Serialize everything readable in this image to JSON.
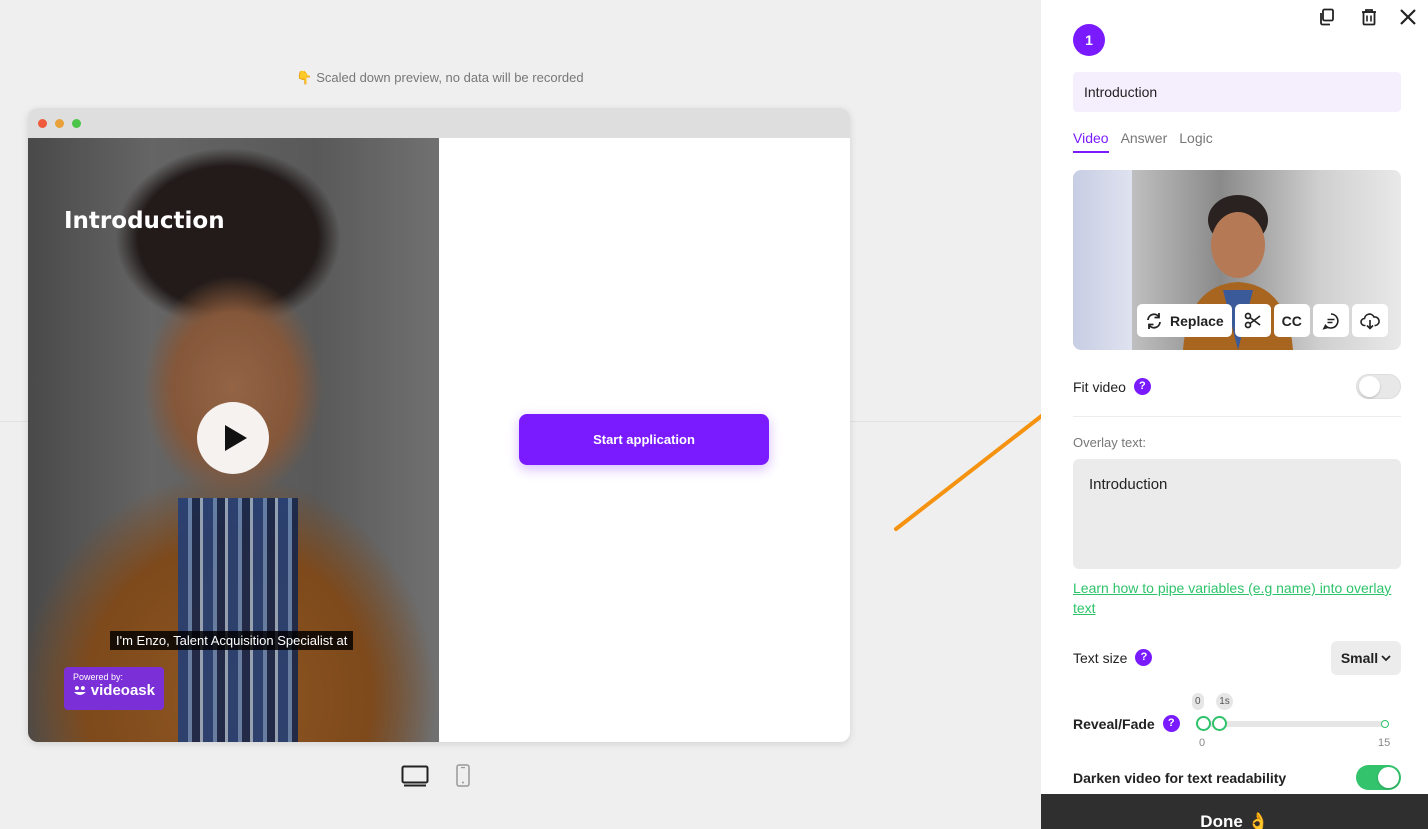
{
  "preview": {
    "note_icon": "👇",
    "note": "Scaled down preview, no data will be recorded",
    "video_title": "Introduction",
    "caption": "I'm Enzo, Talent Acquisition Specialist at",
    "powered_by": "Powered by:",
    "brand": "videoask",
    "start_button": "Start application",
    "devices": [
      "desktop-icon",
      "mobile-icon"
    ]
  },
  "panel": {
    "step_number": "1",
    "title_value": "Introduction",
    "tabs": [
      {
        "label": "Video",
        "active": true
      },
      {
        "label": "Answer",
        "active": false
      },
      {
        "label": "Logic",
        "active": false
      }
    ],
    "video_tools": {
      "replace": "Replace",
      "cc": "CC"
    },
    "fit_video": {
      "label": "Fit video",
      "enabled": false
    },
    "overlay_label": "Overlay text:",
    "overlay_value": "Introduction",
    "learn_link": "Learn how to pipe variables (e.g name) into overlay text",
    "text_size": {
      "label": "Text size",
      "value": "Small"
    },
    "reveal_fade": {
      "label": "Reveal/Fade",
      "bubble_start": "0",
      "bubble_end": "1s",
      "min_label": "0",
      "max_label": "15",
      "range_min": 0,
      "range_max": 15,
      "reveal": 0,
      "fade": 1
    },
    "darken": {
      "label": "Darken video for text readability",
      "enabled": true
    },
    "done": "Done",
    "done_icon": "👌"
  },
  "colors": {
    "accent": "#7a1bff",
    "green": "#2ec36a",
    "arrow": "#f5920f"
  }
}
